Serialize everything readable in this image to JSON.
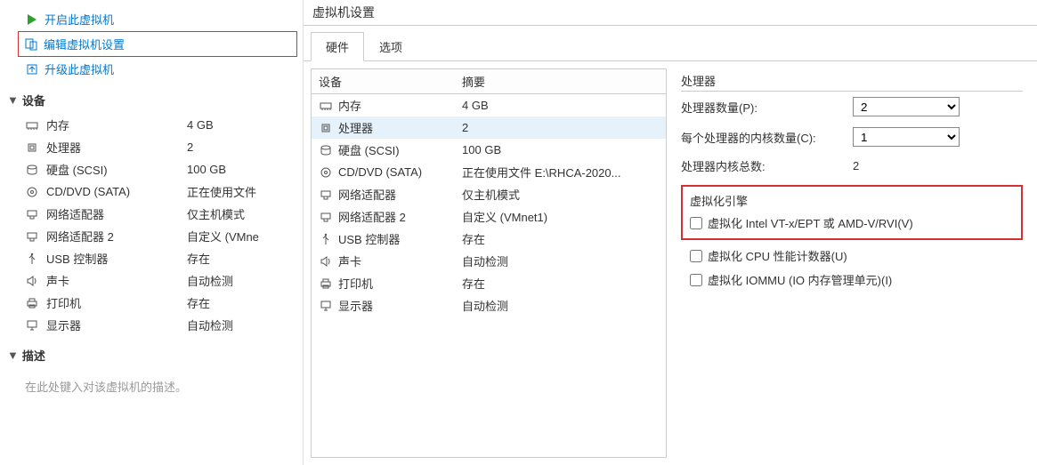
{
  "left": {
    "actions": {
      "start": "开启此虚拟机",
      "edit": "编辑虚拟机设置",
      "upgrade": "升级此虚拟机"
    },
    "sections": {
      "devices_title": "设备",
      "desc_title": "描述",
      "desc_placeholder": "在此处键入对该虚拟机的描述。"
    },
    "devices": [
      {
        "icon": "memory-icon",
        "name": "内存",
        "value": "4 GB"
      },
      {
        "icon": "cpu-icon",
        "name": "处理器",
        "value": "2"
      },
      {
        "icon": "disk-icon",
        "name": "硬盘 (SCSI)",
        "value": "100 GB"
      },
      {
        "icon": "cd-icon",
        "name": "CD/DVD (SATA)",
        "value": "正在使用文件"
      },
      {
        "icon": "net-icon",
        "name": "网络适配器",
        "value": "仅主机模式"
      },
      {
        "icon": "net-icon",
        "name": "网络适配器 2",
        "value": "自定义 (VMne"
      },
      {
        "icon": "usb-icon",
        "name": "USB 控制器",
        "value": "存在"
      },
      {
        "icon": "sound-icon",
        "name": "声卡",
        "value": "自动检测"
      },
      {
        "icon": "printer-icon",
        "name": "打印机",
        "value": "存在"
      },
      {
        "icon": "display-icon",
        "name": "显示器",
        "value": "自动检测"
      }
    ]
  },
  "dialog": {
    "title": "虚拟机设置",
    "tabs": {
      "hw": "硬件",
      "opt": "选项"
    },
    "hw_cols": {
      "device": "设备",
      "summary": "摘要"
    },
    "hw_rows": [
      {
        "icon": "memory-icon",
        "name": "内存",
        "value": "4 GB"
      },
      {
        "icon": "cpu-icon",
        "name": "处理器",
        "value": "2",
        "selected": true
      },
      {
        "icon": "disk-icon",
        "name": "硬盘 (SCSI)",
        "value": "100 GB"
      },
      {
        "icon": "cd-icon",
        "name": "CD/DVD (SATA)",
        "value": "正在使用文件 E:\\RHCA-2020..."
      },
      {
        "icon": "net-icon",
        "name": "网络适配器",
        "value": "仅主机模式"
      },
      {
        "icon": "net-icon",
        "name": "网络适配器 2",
        "value": "自定义 (VMnet1)"
      },
      {
        "icon": "usb-icon",
        "name": "USB 控制器",
        "value": "存在"
      },
      {
        "icon": "sound-icon",
        "name": "声卡",
        "value": "自动检测"
      },
      {
        "icon": "printer-icon",
        "name": "打印机",
        "value": "存在"
      },
      {
        "icon": "display-icon",
        "name": "显示器",
        "value": "自动检测"
      }
    ],
    "cpu": {
      "group_title": "处理器",
      "count_label": "处理器数量(P):",
      "count_value": "2",
      "cores_label": "每个处理器的内核数量(C):",
      "cores_value": "1",
      "total_label": "处理器内核总数:",
      "total_value": "2",
      "virt_title": "虚拟化引擎",
      "cb_vt": "虚拟化 Intel VT-x/EPT 或 AMD-V/RVI(V)",
      "cb_perf": "虚拟化 CPU 性能计数器(U)",
      "cb_iommu": "虚拟化 IOMMU (IO 内存管理单元)(I)"
    }
  }
}
